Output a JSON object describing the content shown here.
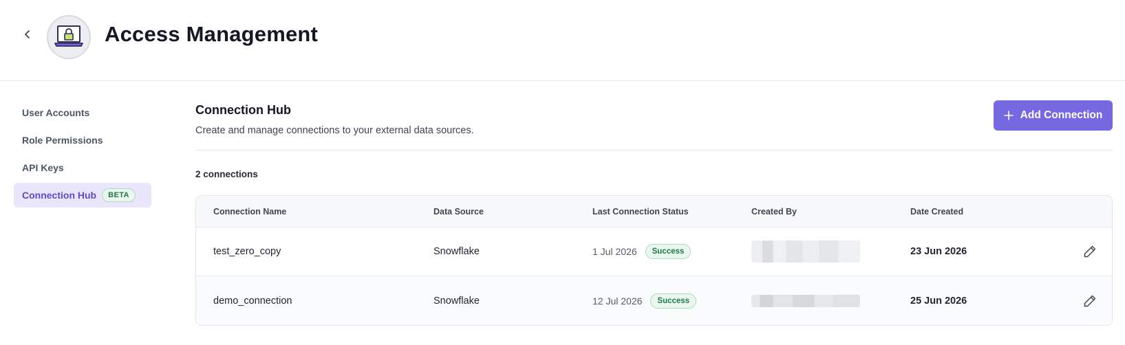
{
  "header": {
    "title": "Access Management",
    "back_icon": "chevron-left-icon",
    "app_icon": "laptop-lock-icon"
  },
  "sidebar": {
    "items": [
      {
        "label": "User Accounts",
        "active": false
      },
      {
        "label": "Role Permissions",
        "active": false
      },
      {
        "label": "API Keys",
        "active": false
      },
      {
        "label": "Connection Hub",
        "active": true,
        "badge": "BETA"
      }
    ]
  },
  "main": {
    "title": "Connection Hub",
    "description": "Create and manage connections to your external data sources.",
    "add_button_label": "Add Connection",
    "count_label": "2 connections"
  },
  "table": {
    "columns": [
      "Connection Name",
      "Data Source",
      "Last Connection Status",
      "Created By",
      "Date Created"
    ],
    "rows": [
      {
        "name": "test_zero_copy",
        "source": "Snowflake",
        "status_date": "1 Jul 2026",
        "status": "Success",
        "created_by": "",
        "date_created": "23 Jun 2026"
      },
      {
        "name": "demo_connection",
        "source": "Snowflake",
        "status_date": "12 Jul 2026",
        "status": "Success",
        "created_by": "",
        "date_created": "25 Jun 2026"
      }
    ]
  },
  "colors": {
    "accent": "#7668e0",
    "accent_text": "#5b4bc9",
    "active_bg": "#e9e6fb",
    "success_text": "#1e7a45",
    "success_bg": "#eaf7ef"
  }
}
